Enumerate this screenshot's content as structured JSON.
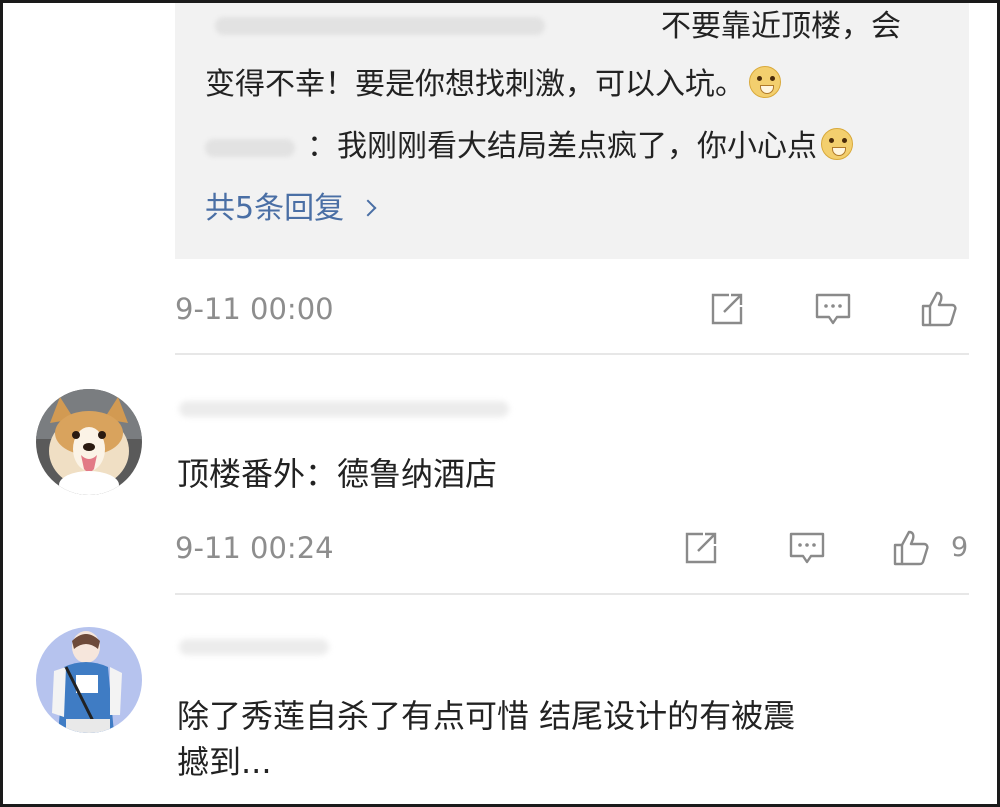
{
  "reply_preview": {
    "line1": "不要靠近顶楼，会",
    "line2": "变得不幸！要是你想找刺激，可以入坑。",
    "line3": "：我刚刚看大结局差点疯了，你小心点",
    "more_replies": "共5条回复"
  },
  "top_meta": {
    "time": "9-11 00:00",
    "like_count": ""
  },
  "comments": [
    {
      "text": "顶楼番外：德鲁纳酒店",
      "time": "9-11 00:24",
      "like_count": "9"
    },
    {
      "text_line1": "除了秀莲自杀了有点可惜 结尾设计的有被震",
      "text_line2": "撼到..."
    }
  ],
  "icons": {
    "share": "share-icon",
    "comment": "comment-icon",
    "like": "thumbs-up-icon",
    "emoji": "doge-emoji-icon"
  },
  "colors": {
    "link": "#4a6fa5",
    "meta": "#8d8d8d",
    "reply_bg": "#f2f2f2"
  }
}
